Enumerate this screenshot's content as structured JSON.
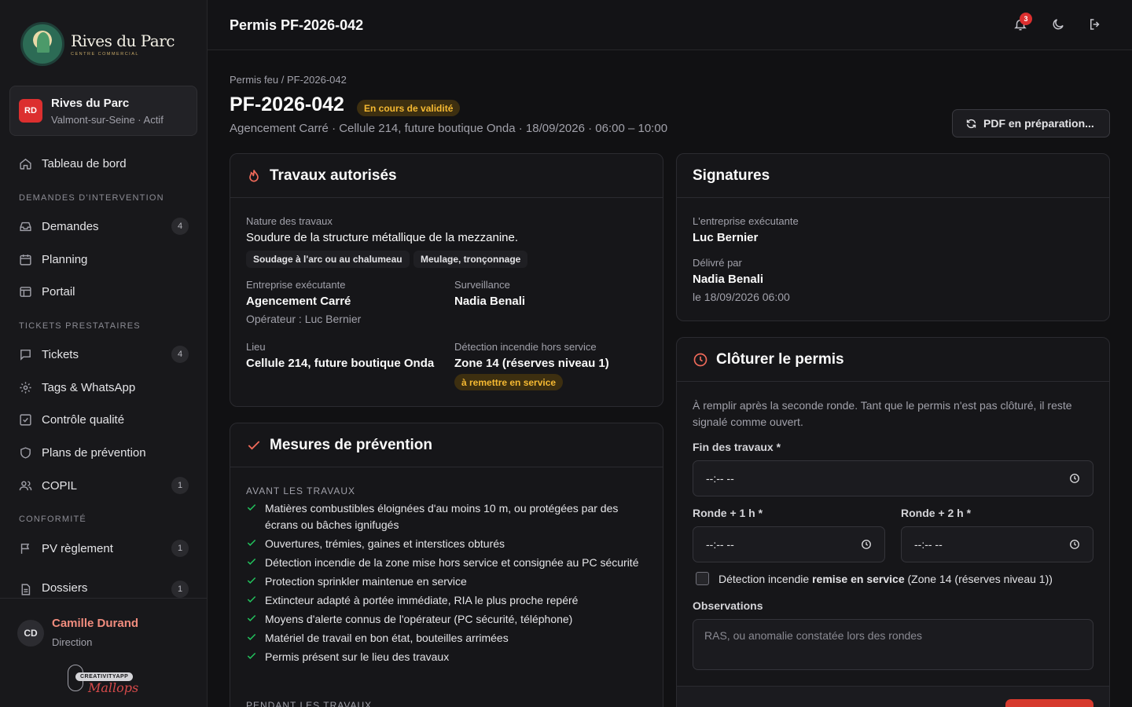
{
  "brand": {
    "name": "Rives du Parc",
    "tagline": "CENTRE COMMERCIAL"
  },
  "site": {
    "initials": "RD",
    "name": "Rives du Parc",
    "subtitle": "Valmont-sur-Seine · Actif"
  },
  "nav": {
    "dashboard": "Tableau de bord",
    "sections": {
      "interventions": "DEMANDES D'INTERVENTION",
      "tickets": "TICKETS PRESTATAIRES",
      "conformite": "CONFORMITÉ"
    },
    "items": {
      "demandes": {
        "label": "Demandes",
        "count": "4"
      },
      "planning": {
        "label": "Planning"
      },
      "portail": {
        "label": "Portail"
      },
      "tickets": {
        "label": "Tickets",
        "count": "4"
      },
      "tags": {
        "label": "Tags & WhatsApp"
      },
      "qualite": {
        "label": "Contrôle qualité"
      },
      "prevention": {
        "label": "Plans de prévention"
      },
      "copil": {
        "label": "COPIL",
        "count": "1"
      },
      "pv": {
        "label": "PV règlement",
        "count": "1"
      },
      "dossiers": {
        "label": "Dossiers d'aménagement",
        "count": "1"
      }
    }
  },
  "user": {
    "initials": "CD",
    "name": "Camille Durand",
    "role": "Direction"
  },
  "credit": {
    "label": "CREATIVITYAPP",
    "signature": "Mallops"
  },
  "topbar": {
    "title": "Permis PF-2026-042",
    "notifications": "3"
  },
  "header": {
    "breadcrumb": "Permis feu  / PF-2026-042",
    "title": "PF-2026-042",
    "status": "En cours de validité",
    "subtitle": "Agencement Carré · Cellule 214, future boutique Onda · 18/09/2026 · 06:00 – 10:00",
    "pdf_button": "PDF en préparation..."
  },
  "travaux": {
    "title": "Travaux autorisés",
    "nature_label": "Nature des travaux",
    "nature_value": "Soudure de la structure métallique de la mezzanine.",
    "chips": [
      "Soudage à l'arc ou au chalumeau",
      "Meulage, tronçonnage"
    ],
    "entreprise_label": "Entreprise exécutante",
    "entreprise_value": "Agencement Carré",
    "operateur": "Opérateur : Luc Bernier",
    "surveillance_label": "Surveillance",
    "surveillance_value": "Nadia Benali",
    "lieu_label": "Lieu",
    "lieu_value": "Cellule 214, future boutique Onda",
    "detection_label": "Détection incendie hors service",
    "detection_value": "Zone 14 (réserves niveau 1)",
    "detection_status": "à remettre en service"
  },
  "mesures": {
    "title": "Mesures de prévention",
    "avant_caption": "AVANT LES TRAVAUX",
    "avant_items": [
      "Matières combustibles éloignées d'au moins 10 m, ou protégées par des écrans ou bâches ignifugés",
      "Ouvertures, trémies, gaines et interstices obturés",
      "Détection incendie de la zone mise hors service et consignée au PC sécurité",
      "Protection sprinkler maintenue en service",
      "Extincteur adapté à portée immédiate, RIA le plus proche repéré",
      "Moyens d'alerte connus de l'opérateur (PC sécurité, téléphone)",
      "Matériel de travail en bon état, bouteilles arrimées",
      "Permis présent sur le lieu des travaux"
    ],
    "pendant_caption": "PENDANT LES TRAVAUX"
  },
  "signatures": {
    "title": "Signatures",
    "entreprise_label": "L'entreprise exécutante",
    "entreprise_value": "Luc Bernier",
    "delivre_label": "Délivré par",
    "delivre_value": "Nadia Benali",
    "delivre_date": "le 18/09/2026 06:00"
  },
  "cloture": {
    "title": "Clôturer le permis",
    "description": "À remplir après la seconde ronde. Tant que le permis n'est pas clôturé, il reste signalé comme ouvert.",
    "fin_label": "Fin des travaux *",
    "ronde1_label": "Ronde + 1 h *",
    "ronde2_label": "Ronde + 2 h *",
    "time_placeholder": "--:-- --",
    "checkbox_prefix": "Détection incendie ",
    "checkbox_bold": "remise en service",
    "checkbox_suffix": " (Zone 14 (réserves niveau 1))",
    "observations_label": "Observations",
    "observations_placeholder": "RAS, ou anomalie constatée lors des rondes"
  }
}
